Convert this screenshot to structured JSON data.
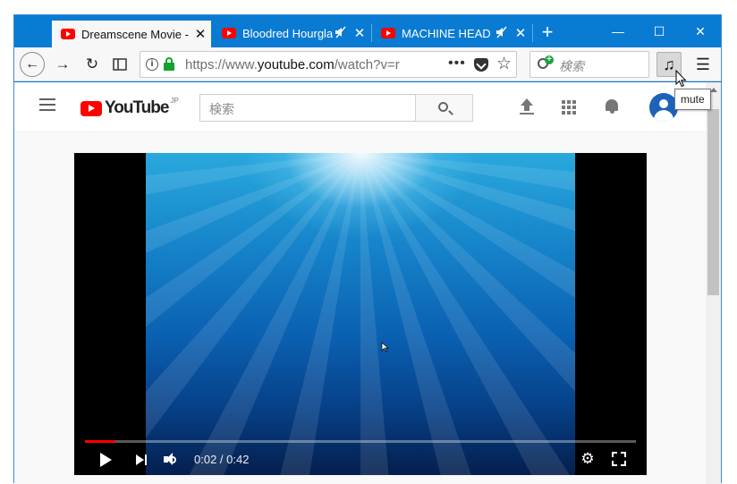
{
  "tabs": [
    {
      "title": "Dreamscene Movie - YouTube",
      "active": true,
      "muted": false
    },
    {
      "title": "Bloodred Hourglass - YouTube",
      "active": false,
      "muted": true
    },
    {
      "title": "MACHINE HEAD - YouTube",
      "active": false,
      "muted": true
    }
  ],
  "toolbar": {
    "url_prefix": "https://www.",
    "url_domain": "youtube.com",
    "url_path": "/watch?v=r",
    "search_placeholder": "検索",
    "music_glyph": "♫",
    "menu_glyph": "☰"
  },
  "window_controls": {
    "minimize": "—",
    "maximize": "☐",
    "close": "✕"
  },
  "youtube": {
    "logo_text": "YouTube",
    "region": "JP",
    "search_placeholder": "検索"
  },
  "player": {
    "time_current": "0:02",
    "time_total": "0:42",
    "time_display": "0:02 / 0:42",
    "progress_fraction": 0.055
  },
  "tooltip": {
    "text": "mute"
  },
  "colors": {
    "accent": "#0a7bd3",
    "youtube_red": "#ff0000",
    "secure_green": "#12a32e"
  }
}
